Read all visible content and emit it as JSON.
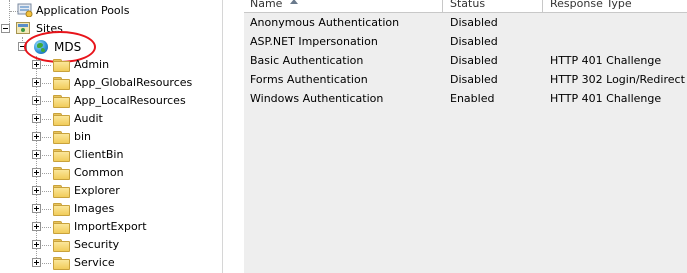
{
  "tree": {
    "app_pools_label": "Application Pools",
    "sites_label": "Sites",
    "site": {
      "label": "MDS",
      "icon": "globe-icon"
    },
    "folders": [
      {
        "label": "Admin"
      },
      {
        "label": "App_GlobalResources"
      },
      {
        "label": "App_LocalResources"
      },
      {
        "label": "Audit"
      },
      {
        "label": "bin"
      },
      {
        "label": "ClientBin"
      },
      {
        "label": "Common"
      },
      {
        "label": "Explorer"
      },
      {
        "label": "Images"
      },
      {
        "label": "ImportExport"
      },
      {
        "label": "Security"
      },
      {
        "label": "Service"
      }
    ]
  },
  "list": {
    "columns": {
      "name": "Name",
      "status": "Status",
      "response_type": "Response Type"
    },
    "sorted_by": "name-ascending",
    "rows": [
      {
        "name": "Anonymous Authentication",
        "status": "Disabled",
        "response_type": ""
      },
      {
        "name": "ASP.NET Impersonation",
        "status": "Disabled",
        "response_type": ""
      },
      {
        "name": "Basic Authentication",
        "status": "Disabled",
        "response_type": "HTTP 401 Challenge"
      },
      {
        "name": "Forms Authentication",
        "status": "Disabled",
        "response_type": "HTTP 302 Login/Redirect"
      },
      {
        "name": "Windows Authentication",
        "status": "Enabled",
        "response_type": "HTTP 401 Challenge"
      }
    ]
  },
  "annotation_color": "#e8141b"
}
